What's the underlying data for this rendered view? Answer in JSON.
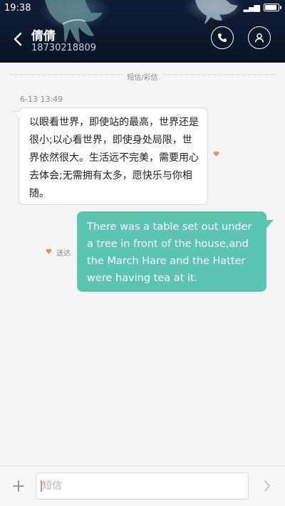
{
  "status_bar": {
    "time": "19:38",
    "signal": "▂▄▆"
  },
  "header": {
    "contact_name": "倩倩",
    "phone_number": "18730218809",
    "icons": {
      "back": "chevron-left-icon",
      "call": "phone-icon",
      "contact": "person-icon"
    }
  },
  "conversation": {
    "divider_label": "短信/彩信",
    "messages": [
      {
        "direction": "incoming",
        "timestamp": "6-13 13:49",
        "text": "以眼看世界，即使站的最高，世界还是很小;以心看世界，即使身处局限，世界依然很大。生活远不完美，需要用心去体会;无需拥有太多，愿快乐与你相随。",
        "marker": "♥"
      },
      {
        "direction": "outgoing",
        "text": "There was a table set out under a tree in front of the house,and the March Hare and the Hatter were having tea at it.",
        "status_marker": "♥",
        "status": "送达"
      }
    ]
  },
  "input_bar": {
    "placeholder": "短信",
    "value": "",
    "icons": {
      "add": "plus-icon",
      "send": "chevron-right-icon"
    }
  },
  "colors": {
    "header_bg": "#0b1426",
    "outgoing_bubble": "#5bc5b1",
    "incoming_bubble": "#ffffff",
    "accent": "#ec8a5c",
    "background": "#f5f5f5"
  }
}
